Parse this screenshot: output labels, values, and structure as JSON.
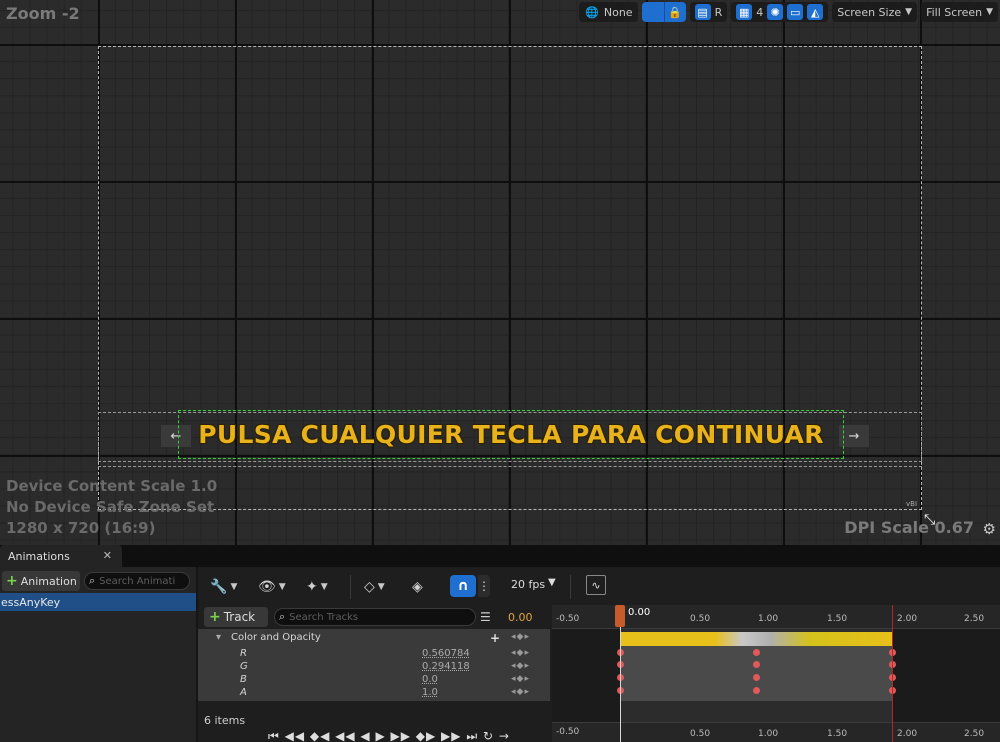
{
  "viewport": {
    "zoom_label": "Zoom -2",
    "toolbar": {
      "none_label": "None",
      "r_label": "R",
      "grid_count": "4",
      "screen_size_label": "Screen Size",
      "fill_screen_label": "Fill Screen"
    },
    "widget_text": "PULSA CUALQUIER TECLA PARA CONTINUAR",
    "arrow_left": "←",
    "arrow_right": "→",
    "info_scale": "Device Content Scale 1.0",
    "info_safe_zone": "No Device Safe Zone Set",
    "info_resolution": "1280 x 720 (16:9)",
    "dpi_scale": "DPI Scale 0.67",
    "small_label": "vBI"
  },
  "animations_panel": {
    "tab_label": "Animations",
    "add_label": "Animation",
    "search_placeholder": "Search Animati",
    "items": [
      "essAnyKey"
    ]
  },
  "sequencer": {
    "fps_label": "20 fps",
    "track_add_label": "Track",
    "search_tracks_placeholder": "Search Tracks",
    "current_time": "0.00",
    "group_label": "Color and Opacity",
    "channels": [
      {
        "name": "R",
        "value": "0.560784"
      },
      {
        "name": "G",
        "value": "0.294118"
      },
      {
        "name": "B",
        "value": "0.0"
      },
      {
        "name": "A",
        "value": "1.0"
      }
    ],
    "items_count": "6 items",
    "playhead_label": "0.00",
    "ruler_labels": [
      "-0.50",
      "0.50",
      "1.00",
      "1.50",
      "2.00",
      "2.50"
    ]
  }
}
